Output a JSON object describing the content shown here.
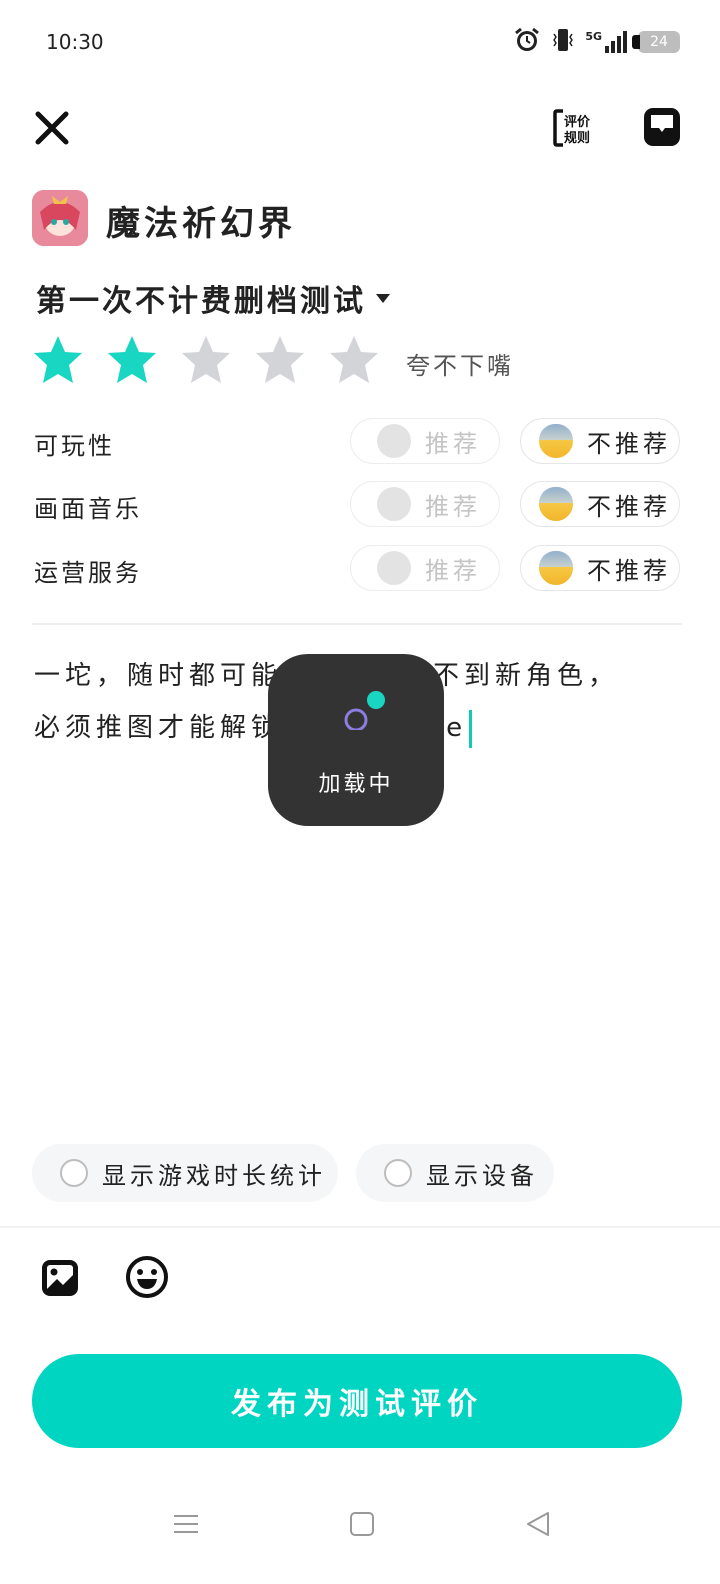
{
  "status_bar": {
    "time": "10:30",
    "network": "5G",
    "battery": "24"
  },
  "header": {
    "close_icon": "close-icon",
    "rules_label": "评价\n规则",
    "message_icon": "chat-icon"
  },
  "game": {
    "name": "魔法祈幻界"
  },
  "version": {
    "label": "第一次不计费删档测试"
  },
  "rating": {
    "value": 2,
    "max": 5,
    "text": "夸不下嘴",
    "active_color": "#19d6c3",
    "inactive_color": "#d2d4d8"
  },
  "categories": [
    {
      "label": "可玩性",
      "recommend": "推荐",
      "not_recommend": "不推荐"
    },
    {
      "label": "画面音乐",
      "recommend": "推荐",
      "not_recommend": "不推荐"
    },
    {
      "label": "运营服务",
      "recommend": "推荐",
      "not_recommend": "不推荐"
    }
  ],
  "review": {
    "line1_a": "一坨，随时都可能",
    "line1_b": "抽不到新角色，",
    "line2_a": "必须推图才能解锁",
    "line2_b": "搬re"
  },
  "loading": {
    "text": "加载中"
  },
  "options": {
    "show_playtime": "显示游戏时长统计",
    "show_device": "显示设备"
  },
  "toolbar": {
    "image_icon": "image-icon",
    "emoji_icon": "emoji-icon"
  },
  "publish": {
    "label": "发布为测试评价"
  },
  "colors": {
    "accent": "#00d5c2",
    "overlay": "#333333"
  }
}
